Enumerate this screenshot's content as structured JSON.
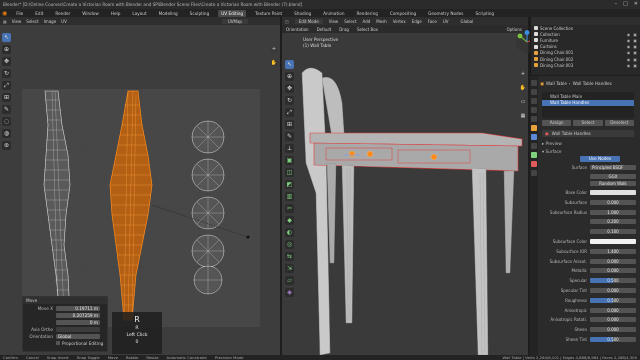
{
  "window": {
    "title": "Blender* [D:\\Online Courses\\Create a Victorian Room with Blender and SP\\Blender Scene Files\\Create a Victorian Room with Blender (7).blend]"
  },
  "menu": {
    "items": [
      "File",
      "Edit",
      "Render",
      "Window",
      "Help"
    ],
    "workspaces": [
      "Layout",
      "Modeling",
      "Sculpting",
      "UV Editing",
      "Texture Paint",
      "Shading",
      "Animation",
      "Rendering",
      "Compositing",
      "Geometry Nodes",
      "Scripting"
    ],
    "active_workspace": "UV Editing"
  },
  "uv_editor": {
    "header": [
      "View",
      "Select",
      "Image",
      "UV"
    ],
    "image_name": "UVMap",
    "move_panel": {
      "title": "Move",
      "move_label": "Move X",
      "move_x": "0.19711 m",
      "move_y": "0.207259 m",
      "move_z": "0 m",
      "axis_ortho_label": "Axis Ortho",
      "orientation_label": "Orientation",
      "orientation_value": "Global",
      "proportional_label": "Proportional Editing"
    },
    "key_overlay": {
      "key": "R",
      "sub": "R",
      "action": "Left Click",
      "count": "0"
    }
  },
  "viewport": {
    "mode": "Edit Mode",
    "header": [
      "View",
      "Select",
      "Add",
      "Mesh",
      "Vertex",
      "Edge",
      "Face",
      "UV"
    ],
    "header2": [
      "Orientation",
      "Default",
      "Drag",
      "Select Box"
    ],
    "transform": "Global",
    "perspective": "User Perspective",
    "object_name": "(1) Wall Table",
    "options_label": "Options"
  },
  "outliner": {
    "title": "Scene Collection",
    "items": [
      {
        "label": "Scene Collection",
        "color": "#cfcfcf"
      },
      {
        "label": "Collection",
        "color": "#cfcfcf"
      },
      {
        "label": "Furniture",
        "color": "#cfcfcf"
      },
      {
        "label": "Curtains",
        "color": "#cfcfcf"
      },
      {
        "label": "Dining Chair.001",
        "color": "#e8a23c"
      },
      {
        "label": "Dining Chair.002",
        "color": "#e8a23c"
      },
      {
        "label": "Dining Chair.003",
        "color": "#e8a23c"
      }
    ]
  },
  "properties": {
    "object": "Wall Table",
    "material_slot_header": "Wall Table Handles",
    "slots": [
      "Wall Table Main",
      "Wall Table Handles"
    ],
    "material_name": "Wall Table Handles",
    "buttons": [
      "Assign",
      "Select",
      "Deselect"
    ],
    "preview_label": "Preview",
    "surface_label": "Surface",
    "use_nodes": "Use Nodes",
    "surface": "Principled BSDF",
    "distribution": "GGX",
    "subsurface_method": "Random Walk",
    "rows": [
      {
        "label": "Base Color",
        "value": "",
        "fill": 0
      },
      {
        "label": "Subsurface",
        "value": "0.000",
        "fill": 0
      },
      {
        "label": "Subsurface Radius",
        "value": "1.000",
        "fill": 0
      },
      {
        "label": "",
        "value": "0.200",
        "fill": 0
      },
      {
        "label": "",
        "value": "0.100",
        "fill": 0
      },
      {
        "label": "Subsurface Color",
        "value": "",
        "fill": 0
      },
      {
        "label": "Subsurface IOR",
        "value": "1.400",
        "fill": 0
      },
      {
        "label": "Subsurface Anisot.",
        "value": "0.000",
        "fill": 0
      },
      {
        "label": "Metallic",
        "value": "0.000",
        "fill": 0
      },
      {
        "label": "Specular",
        "value": "0.500",
        "fill": 0.5
      },
      {
        "label": "Specular Tint",
        "value": "0.000",
        "fill": 0
      },
      {
        "label": "Roughness",
        "value": "0.500",
        "fill": 0.5
      },
      {
        "label": "Anisotropic",
        "value": "0.000",
        "fill": 0
      },
      {
        "label": "Anisotropic Rotati.",
        "value": "0.000",
        "fill": 0
      },
      {
        "label": "Sheen",
        "value": "0.000",
        "fill": 0
      },
      {
        "label": "Sheen Tint",
        "value": "0.500",
        "fill": 0.5
      }
    ]
  },
  "status": {
    "left": [
      "Confirm",
      "Cancel",
      "Snap Invert",
      "Snap Toggle",
      "Move",
      "Rotate",
      "Resize",
      "Automatic Constraint",
      "Precision Mode"
    ],
    "right": "Wall Table | Verts 2,264/6,101 | Edges 4,888/8,984 | Faces 2,288/4,305"
  },
  "colors": {
    "accent": "#4772b3",
    "selection": "#ff8c1a",
    "edge_select": "#e23b3b"
  }
}
